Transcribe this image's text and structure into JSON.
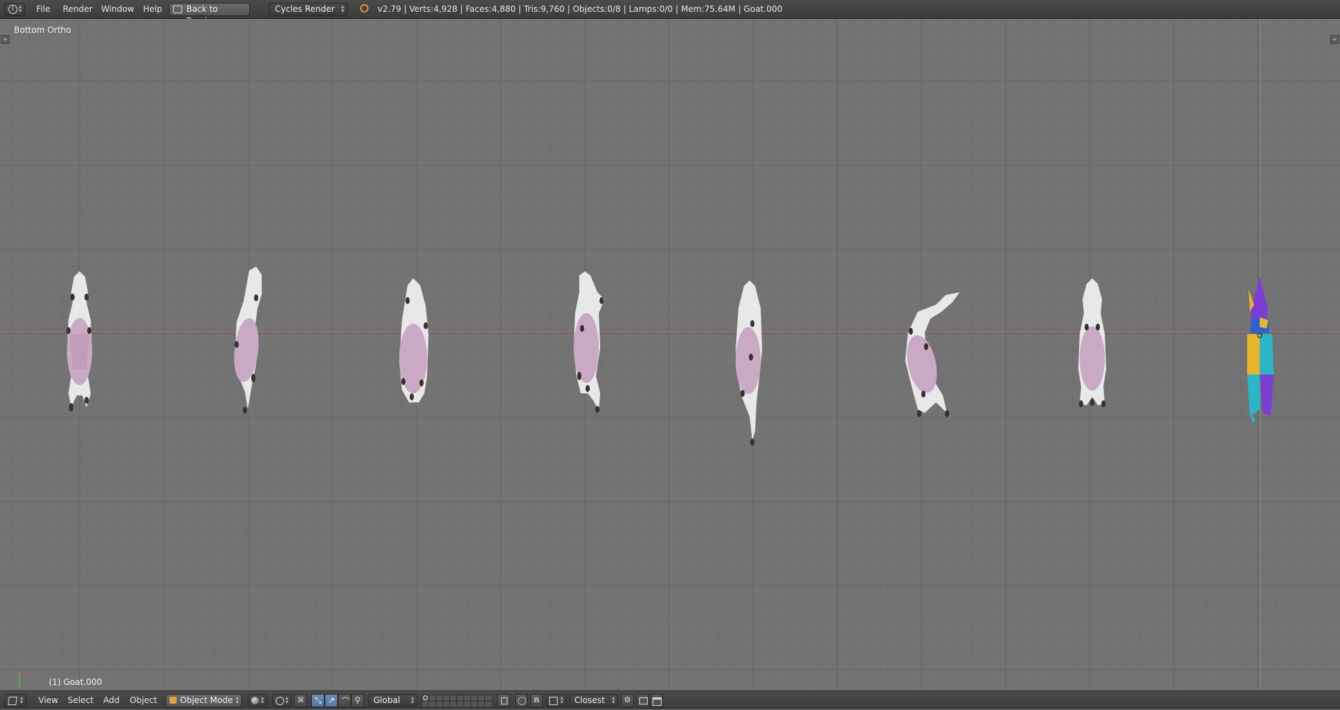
{
  "topbar": {
    "menus": [
      "File",
      "Render",
      "Window",
      "Help"
    ],
    "back_button": "Back to Previous",
    "render_engine": "Cycles Render",
    "stats": "v2.79 | Verts:4,928 | Faces:4,880 | Tris:9,760 | Objects:0/8 | Lamps:0/0 | Mem:75.64M | Goat.000"
  },
  "viewport": {
    "view_name": "Bottom Ortho",
    "active_object": "(1) Goat.000"
  },
  "bottombar": {
    "menus": [
      "View",
      "Select",
      "Add",
      "Object"
    ],
    "mode": "Object Mode",
    "orientation": "Global",
    "snap_target": "Closest"
  },
  "colors": {
    "goat_body": "#c9a9c3",
    "goat_white": "#e8e8e8",
    "goat_hoof": "#3a2e2e",
    "selected_yellow": "#e8b52a",
    "selected_cyan": "#2ab5c8",
    "selected_purple": "#7a3fd0",
    "selected_blue": "#2e5fd0"
  },
  "icons": [
    "info-icon",
    "back-icon",
    "blender-logo-icon",
    "cube-icon",
    "object-mode-icon",
    "shading-sphere-icon",
    "pivot-icon",
    "manipulator-icon",
    "translate-icon",
    "rotate-icon",
    "scale-icon",
    "layers-icon",
    "lock-icon",
    "proportional-icon",
    "snap-icon",
    "render-icon",
    "camera-icon"
  ]
}
